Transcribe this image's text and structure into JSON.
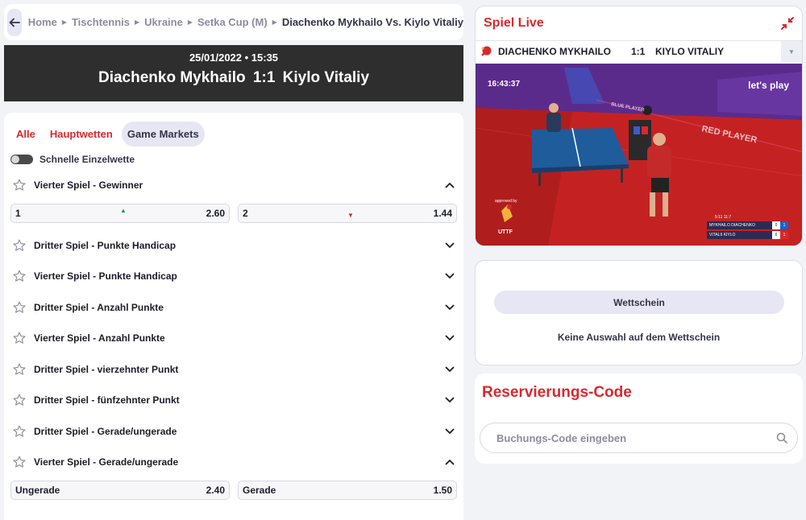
{
  "breadcrumb": {
    "items": [
      "Home",
      "Tischtennis",
      "Ukraine",
      "Setka Cup (M)"
    ],
    "current": "Diachenko Mykhailo Vs. Kiylo Vitaliy"
  },
  "match": {
    "date_time": "25/01/2022 • 15:35",
    "home": "Diachenko Mykhailo",
    "score": "1:1",
    "away": "Kiylo Vitaliy"
  },
  "tabs": [
    {
      "label": "Alle",
      "active": false
    },
    {
      "label": "Hauptwetten",
      "active": false
    },
    {
      "label": "Game Markets",
      "active": true
    }
  ],
  "quick_bet": {
    "label": "Schnelle Einzelwette",
    "on": false
  },
  "markets": [
    {
      "name": "Vierter Spiel - Gewinner",
      "expanded": true,
      "odds": [
        {
          "label": "1",
          "value": "2.60",
          "trend": "up"
        },
        {
          "label": "2",
          "value": "1.44",
          "trend": "down"
        }
      ]
    },
    {
      "name": "Dritter Spiel - Punkte Handicap",
      "expanded": false
    },
    {
      "name": "Vierter Spiel - Punkte Handicap",
      "expanded": false
    },
    {
      "name": "Dritter Spiel - Anzahl Punkte",
      "expanded": false
    },
    {
      "name": "Vierter Spiel - Anzahl Punkte",
      "expanded": false
    },
    {
      "name": "Dritter Spiel - vierzehnter Punkt",
      "expanded": false
    },
    {
      "name": "Dritter Spiel - fünfzehnter Punkt",
      "expanded": false
    },
    {
      "name": "Dritter Spiel - Gerade/ungerade",
      "expanded": false
    },
    {
      "name": "Vierter Spiel - Gerade/ungerade",
      "expanded": true,
      "odds": [
        {
          "label": "Ungerade",
          "value": "2.40",
          "trend": ""
        },
        {
          "label": "Gerade",
          "value": "1.50",
          "trend": ""
        }
      ]
    }
  ],
  "live": {
    "title": "Spiel Live",
    "home_upper": "DIACHENKO MYKHAILO",
    "score": "1:1",
    "away_upper": "KIYLO VITALIY",
    "video": {
      "clock": "16:43:37",
      "slogan": "let's play",
      "approved": "approved by",
      "federation": "UTTF",
      "set_header": "5:11   11:7",
      "rows": [
        {
          "name": "MYKHAILO DIACHENKO",
          "games": "0",
          "points": "1",
          "color": "#1f5fd0"
        },
        {
          "name": "VITALII KIYLO",
          "games": "6",
          "points": "1",
          "color": "#d9282f"
        }
      ]
    }
  },
  "betslip": {
    "tab_label": "Wettschein",
    "empty_text": "Keine Auswahl auf dem Wettschein"
  },
  "reservation": {
    "title": "Reservierungs-Code",
    "placeholder": "Buchungs-Code eingeben"
  },
  "colors": {
    "accent_red": "#d9282f",
    "pill": "#e6e6f4",
    "header_dark": "#2e2e2e"
  }
}
